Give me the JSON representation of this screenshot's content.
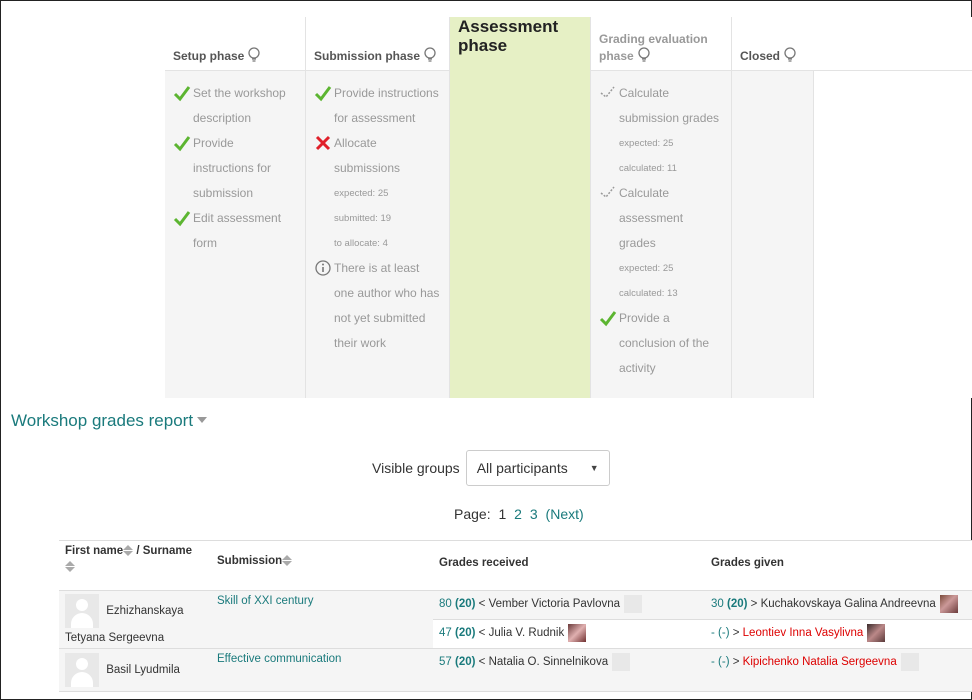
{
  "phases": [
    {
      "title": "Setup phase",
      "tasks": [
        {
          "status": "done",
          "label": "Set the workshop description"
        },
        {
          "status": "done",
          "label": "Provide instructions for submission"
        },
        {
          "status": "done",
          "label": "Edit assessment form"
        }
      ]
    },
    {
      "title": "Submission phase",
      "tasks": [
        {
          "status": "done",
          "label": "Provide instructions for assessment"
        },
        {
          "status": "fail",
          "label": "Allocate submissions",
          "details": [
            "expected: 25",
            "submitted: 19",
            "to allocate: 4"
          ]
        },
        {
          "status": "info",
          "label": "There is at least one author who has not yet submitted their work"
        }
      ]
    },
    {
      "title": "Assessment phase",
      "tasks": []
    },
    {
      "title": "Grading evaluation phase",
      "tasks": [
        {
          "status": "todo",
          "label": "Calculate submission grades",
          "details": [
            "expected: 25",
            "calculated: 11"
          ]
        },
        {
          "status": "todo",
          "label": "Calculate assessment grades",
          "details": [
            "expected: 25",
            "calculated: 13"
          ]
        },
        {
          "status": "done",
          "label": "Provide a conclusion of the activity"
        }
      ]
    },
    {
      "title": "Closed",
      "tasks": []
    }
  ],
  "report": {
    "title": "Workshop grades report",
    "groups_label": "Visible groups",
    "groups_selected": "All participants",
    "page_label": "Page:",
    "pages": [
      "1",
      "2",
      "3"
    ],
    "next_label": "(Next)"
  },
  "table": {
    "headers": {
      "name_first": "First name",
      "name_sep": " / Surname",
      "submission": "Submission",
      "received": "Grades received",
      "given": "Grades given"
    },
    "rows": [
      {
        "name_a": "Ezhizhanskaya",
        "name_b": "Tetyana Sergeevna",
        "submission": "Skill of XXI century",
        "received": [
          {
            "grade": "80",
            "of": "(20)",
            "sep": " < ",
            "who": "Vember Victoria Pavlovna"
          },
          {
            "grade": "47",
            "of": "(20)",
            "sep": " < ",
            "who": "Julia V. Rudnik"
          }
        ],
        "given": [
          {
            "grade": "30",
            "of": "(20)",
            "sep": " > ",
            "who": "Kuchakovskaya Galina Andreevna"
          },
          {
            "grade": "-",
            "of": "(-)",
            "sep": " > ",
            "who": "Leontiev Inna Vasylivna"
          }
        ]
      },
      {
        "name_a": "Basil Lyudmila",
        "submission": "Effective communication",
        "received": [
          {
            "grade": "57",
            "of": "(20)",
            "sep": " < ",
            "who": "Natalia O. Sinnelnikova"
          }
        ],
        "given": [
          {
            "grade": "-",
            "of": "(-)",
            "sep": " > ",
            "who": "Kipichenko Natalia Sergeevna"
          }
        ]
      }
    ]
  },
  "colors": {
    "accent": "#1a7a7c",
    "active_phase": "#e6f0c5",
    "done_check": "#5cb531",
    "fail_cross": "#e0202a",
    "missing_red": "#dd0000"
  }
}
